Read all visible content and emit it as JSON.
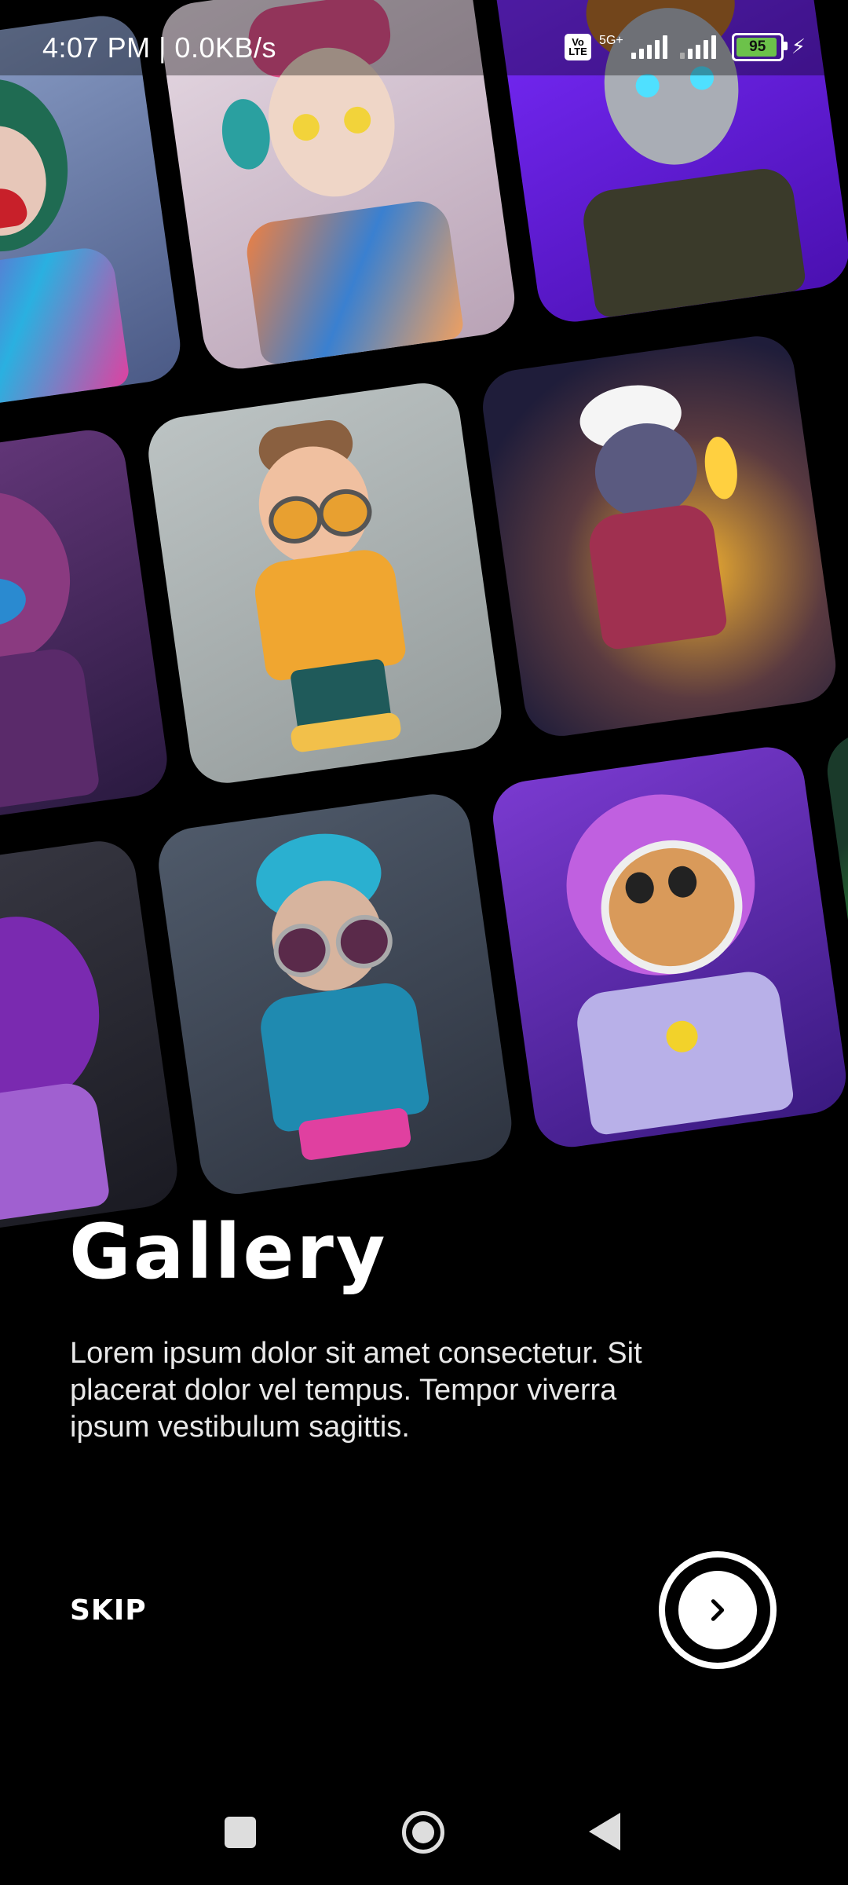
{
  "status_bar": {
    "time_speed": "4:07 PM | 0.0KB/s",
    "volte": "Vo LTE",
    "network": "5G+",
    "battery_percent": "95",
    "battery_level": 0.95
  },
  "onboarding": {
    "title": "Gallery",
    "description": "Lorem ipsum dolor sit amet consectetur. Sit placerat dolor vel tempus. Tempor viverra ipsum vestibulum sagittis.",
    "skip_label": "SKIP",
    "next_icon": "chevron-right-icon"
  },
  "gallery_items": [
    {
      "subject": "green-haired girl with red mask",
      "bg": "#7a8bb0"
    },
    {
      "subject": "anime girl with pink bow",
      "bg": "#c9b8c7"
    },
    {
      "subject": "robot anime boy",
      "bg": "#6a1fd0"
    },
    {
      "subject": "hooded character with goggles",
      "bg": "#5a2c6b"
    },
    {
      "subject": "boy in yellow jacket and goggles",
      "bg": "#a9b0b0"
    },
    {
      "subject": "cat warrior with torch",
      "bg": "#2d2850"
    },
    {
      "subject": "purple wizard",
      "bg": "#3b3a45"
    },
    {
      "subject": "kid with headphones and goggles",
      "bg": "#4b5564"
    },
    {
      "subject": "astronaut cat",
      "bg": "#5a2aa8"
    },
    {
      "subject": "green glowing character",
      "bg": "#1a3a2a"
    }
  ],
  "colors": {
    "background": "#000000",
    "text": "#ffffff",
    "battery": "#6cc24a"
  }
}
